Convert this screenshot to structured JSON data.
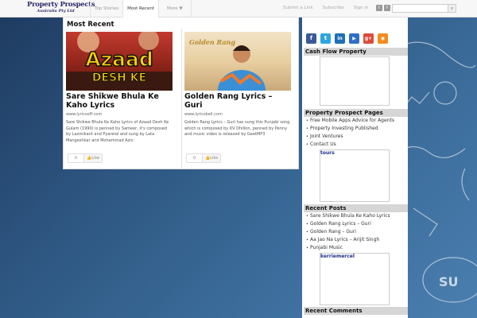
{
  "logo": {
    "line1": "Property Prospects",
    "line2": "Australia Pty Ltd"
  },
  "nav": {
    "tabs": [
      {
        "label": "Top Stories"
      },
      {
        "label": "Most Recent"
      },
      {
        "label": "More ▼"
      }
    ],
    "links": [
      "Submit a Link",
      "Subscribe",
      "Sign in"
    ]
  },
  "main": {
    "section_title": "Most Recent",
    "posts": [
      {
        "image_text_1": "Azaad",
        "image_text_2": "DESH KE",
        "title": "Sare Shikwe Bhula Ke Kaho Lyrics",
        "source": "www.lyricsoff.com",
        "excerpt": "Sare Shikwe Bhula Ke Kaho Lyrics of Azaad Desh Ke Gulam (1990) is penned by Sameer, it's composed by Laxmikant and Pyarelal and sung by Lata Mangeshkar and Mohammad Aziz.",
        "like_count": "0",
        "like_label": "Like"
      },
      {
        "image_text_1": "Golden Rang",
        "title": "Golden Rang Lyrics – Guri",
        "source": "www.lyricsbell.com",
        "excerpt": "Golden Rang Lyrics – Guri has sung this Punjabi song which is composed by KV Dhillon, penned by Penny and music video is released by GeetMP3",
        "like_count": "0",
        "like_label": "Like"
      }
    ]
  },
  "sidebar": {
    "social_icons": [
      {
        "icon": "facebook-icon",
        "glyph": "f",
        "color": "#3b5998"
      },
      {
        "icon": "twitter-icon",
        "glyph": "t",
        "color": "#2da6e0"
      },
      {
        "icon": "linkedin-icon",
        "glyph": "in",
        "color": "#1e6fb5"
      },
      {
        "icon": "youtube-icon",
        "glyph": "▶",
        "color": "#2f6fc4"
      },
      {
        "icon": "googleplus-icon",
        "glyph": "g+",
        "color": "#dd4b39"
      },
      {
        "icon": "rss-icon",
        "glyph": "◉",
        "color": "#f28c1e"
      }
    ],
    "cash_flow": {
      "title": "Cash Flow Property"
    },
    "pages": {
      "title": "Property Prospect Pages",
      "items": [
        "Free Mobile Apps Advice for Agents",
        "Property Investing Published",
        "Joint Ventures",
        "Contact Us"
      ],
      "frame_label": "tours"
    },
    "recent_posts": {
      "title": "Recent Posts",
      "items": [
        "Sare Shikwe Bhula Ke Kaho Lyrics",
        "Golden Rang Lyrics – Guri",
        "Golden Rang – Guri",
        "Aa Jao Na Lyrics – Arijit Singh",
        "Punjabi Music"
      ],
      "frame_label": "kerriemercel"
    },
    "recent_comments": {
      "title": "Recent Comments"
    }
  }
}
